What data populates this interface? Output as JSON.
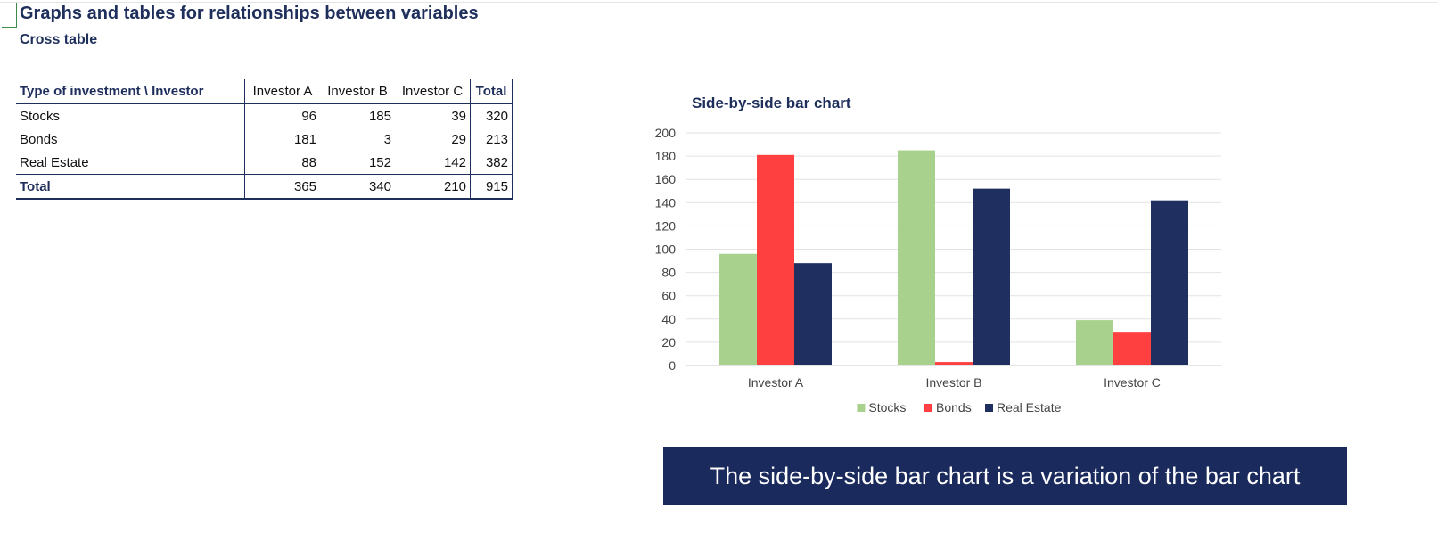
{
  "header": {
    "title": "Graphs and tables for relationships between variables",
    "subtitle": "Cross table"
  },
  "cross_table": {
    "corner_label": "Type of investment \\ Investor",
    "columns": [
      "Investor A",
      "Investor B",
      "Investor C"
    ],
    "total_label": "Total",
    "rows": [
      {
        "label": "Stocks",
        "values": [
          "96",
          "185",
          "39"
        ],
        "total": "320"
      },
      {
        "label": "Bonds",
        "values": [
          "181",
          "3",
          "29"
        ],
        "total": "213"
      },
      {
        "label": "Real Estate",
        "values": [
          "88",
          "152",
          "142"
        ],
        "total": "382"
      }
    ],
    "totals_row": {
      "label": "Total",
      "values": [
        "365",
        "340",
        "210"
      ],
      "total": "915"
    }
  },
  "chart_data": {
    "type": "bar",
    "title": "Side-by-side bar chart",
    "categories": [
      "Investor A",
      "Investor B",
      "Investor C"
    ],
    "series": [
      {
        "name": "Stocks",
        "color": "#a9d18e",
        "values": [
          96,
          185,
          39
        ]
      },
      {
        "name": "Bonds",
        "color": "#ff4040",
        "values": [
          181,
          3,
          29
        ]
      },
      {
        "name": "Real Estate",
        "color": "#1f3060",
        "values": [
          88,
          152,
          142
        ]
      }
    ],
    "ylim": [
      0,
      200
    ],
    "yticks": [
      0,
      20,
      40,
      60,
      80,
      100,
      120,
      140,
      160,
      180,
      200
    ],
    "grid": true,
    "legend_position": "bottom"
  },
  "banner": {
    "text": "The side-by-side bar chart is a variation of the bar chart"
  },
  "colors": {
    "heading": "#1f2f5c",
    "banner_bg": "#1b2a5c"
  }
}
